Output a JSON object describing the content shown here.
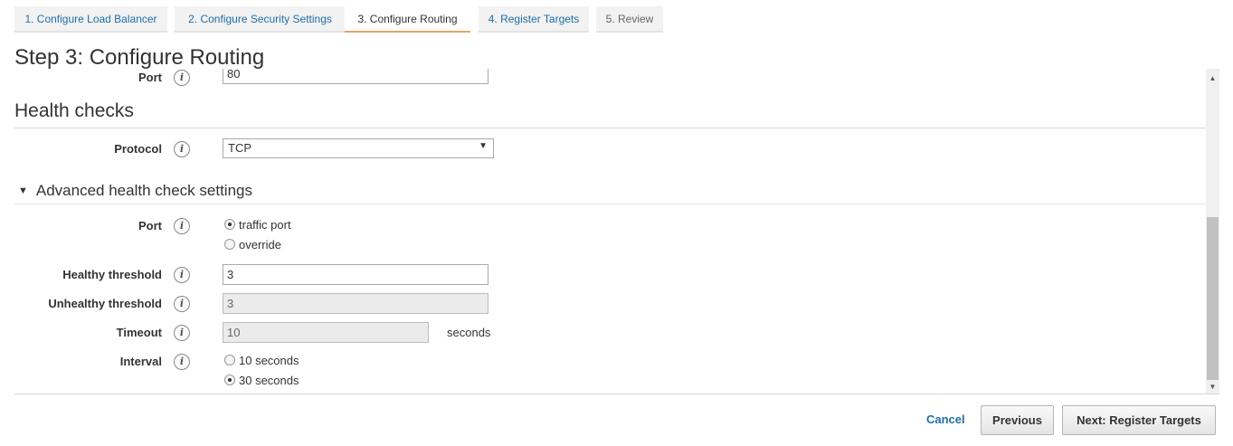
{
  "wizard": {
    "tabs": [
      {
        "label": "1. Configure Load Balancer"
      },
      {
        "label": "2. Configure Security Settings"
      },
      {
        "label": "3. Configure Routing"
      },
      {
        "label": "4. Register Targets"
      },
      {
        "label": "5. Review"
      }
    ],
    "active_tab": 2
  },
  "page": {
    "title": "Step 3: Configure Routing"
  },
  "target_group": {
    "port_label": "Port",
    "port_value": "80"
  },
  "health_checks": {
    "title": "Health checks",
    "protocol_label": "Protocol",
    "protocol_value": "TCP"
  },
  "advanced": {
    "title": "Advanced health check settings",
    "port_label": "Port",
    "port_options": [
      "traffic port",
      "override"
    ],
    "port_selected": "traffic port",
    "healthy_label": "Healthy threshold",
    "healthy_value": "3",
    "unhealthy_label": "Unhealthy threshold",
    "unhealthy_value": "3",
    "timeout_label": "Timeout",
    "timeout_value": "10",
    "timeout_unit": "seconds",
    "interval_label": "Interval",
    "interval_options": [
      "10 seconds",
      "30 seconds"
    ],
    "interval_selected": "30 seconds"
  },
  "footer": {
    "cancel_label": "Cancel",
    "previous_label": "Previous",
    "next_label": "Next: Register Targets"
  },
  "colors": {
    "link": "#1f6ea8",
    "active_tab_underline": "#e0a46b"
  },
  "icons": {
    "info": "info-icon",
    "expand": "triangle-down-icon",
    "scroll_up": "scroll-up-icon",
    "scroll_down": "scroll-down-icon"
  }
}
